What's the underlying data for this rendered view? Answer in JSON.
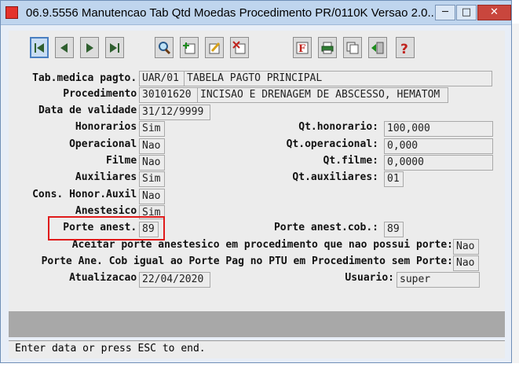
{
  "window": {
    "title": "06.9.5556 Manutencao  Tab Qtd Moedas Procedimento PR/0110K Versao 2.0...",
    "minimize": "─",
    "maximize": "□",
    "close": "✕"
  },
  "toolbar": {
    "buttons": [
      "first-record",
      "previous-record",
      "next-record",
      "last-record",
      "search",
      "add",
      "edit",
      "delete",
      "filter",
      "print",
      "copy",
      "exit",
      "help"
    ]
  },
  "form": {
    "tab_medica_label": "Tab.medica pagto.:",
    "tab_medica_code": "UAR/01",
    "tab_medica_desc": "TABELA PAGTO PRINCIPAL",
    "procedimento_label": "Procedimento:",
    "procedimento_code": "30101620",
    "procedimento_desc": "INCISAO E DRENAGEM DE ABSCESSO, HEMATOM",
    "data_validade_label": "Data de validade:",
    "data_validade": "31/12/9999",
    "honorarios_label": "Honorarios:",
    "honorarios": "Sim",
    "qt_honorario_label": "Qt.honorario:",
    "qt_honorario": "100,000",
    "operacional_label": "Operacional:",
    "operacional": "Nao",
    "qt_operacional_label": "Qt.operacional:",
    "qt_operacional": "0,000",
    "filme_label": "Filme:",
    "filme": "Nao",
    "qt_filme_label": "Qt.filme:",
    "qt_filme": "0,0000",
    "auxiliares_label": "Auxiliares:",
    "auxiliares": "Sim",
    "qt_auxiliares_label": "Qt.auxiliares:",
    "qt_auxiliares": "01",
    "cons_honor_label": "Cons. Honor.Auxil:",
    "cons_honor": "Nao",
    "anestesico_label": "Anestesico:",
    "anestesico": "Sim",
    "porte_anest_label": "Porte anest.:",
    "porte_anest": "89",
    "porte_anest_cob_label": "Porte anest.cob.:",
    "porte_anest_cob": "89",
    "aceitar_label": "Aceitar porte anestesico em procedimento que nao possui porte:",
    "aceitar": "Nao",
    "porte_ane_cob_label": "Porte Ane. Cob igual ao Porte Pag no PTU em Procedimento sem Porte:",
    "porte_ane_cob": "Nao",
    "atualizacao_label": "Atualizacao:",
    "atualizacao": "22/04/2020",
    "usuario_label": "Usuario:",
    "usuario": "super"
  },
  "status": {
    "message": "Enter data or press ESC to end."
  },
  "colors": {
    "highlight": "#e01b1b",
    "titlebar": "#bfd5ee"
  }
}
